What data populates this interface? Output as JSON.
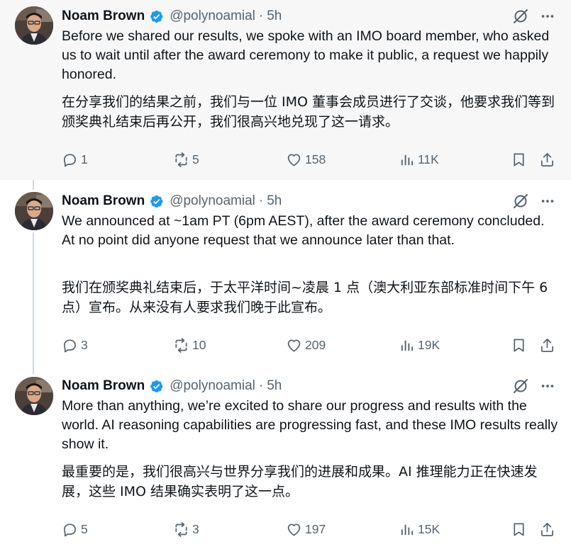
{
  "tweets": [
    {
      "author": "Noam Brown",
      "handle": "@polynoamial",
      "separator": "·",
      "time": "5h",
      "text_en": "Before we shared our results, we spoke with an IMO board member, who asked us to wait until after the award ceremony to make it public, a request we happily honored.",
      "text_zh": "在分享我们的结果之前，我们与一位 IMO 董事会成员进行了交谈，他要求我们等到颁奖典礼结束后再公开，我们很高兴地兑现了这一请求。",
      "replies": "1",
      "reposts": "5",
      "likes": "158",
      "views": "11K"
    },
    {
      "author": "Noam Brown",
      "handle": "@polynoamial",
      "separator": "·",
      "time": "5h",
      "text_en": "We announced at ~1am PT (6pm AEST), after the award ceremony concluded. At no point did anyone request that we announce later than that.",
      "text_zh": "我们在颁奖典礼结束后，于太平洋时间~凌晨 1 点（澳大利亚东部标准时间下午 6 点）宣布。从来没有人要求我们晚于此宣布。",
      "replies": "3",
      "reposts": "10",
      "likes": "209",
      "views": "19K"
    },
    {
      "author": "Noam Brown",
      "handle": "@polynoamial",
      "separator": "·",
      "time": "5h",
      "text_en": "More than anything, we’re excited to share our progress and results with the world. AI reasoning capabilities are progressing fast, and these IMO results really show it.",
      "text_zh": "最重要的是，我们很高兴与世界分享我们的进展和成果。AI 推理能力正在快速发展，这些 IMO 结果确实表明了这一点。",
      "replies": "5",
      "reposts": "3",
      "likes": "197",
      "views": "15K"
    }
  ],
  "icons": {
    "verified": "verified-badge-icon",
    "grok": "grok-icon",
    "more": "more-icon",
    "reply": "reply-icon",
    "repost": "repost-icon",
    "like": "like-icon",
    "views": "views-icon",
    "bookmark": "bookmark-icon",
    "share": "share-icon"
  },
  "colors": {
    "verified": "#1d9bf0",
    "text": "#0f1419",
    "secondary": "#536471",
    "highlight_bg": "#f7f7f7",
    "thread_line": "#cfd9de"
  }
}
